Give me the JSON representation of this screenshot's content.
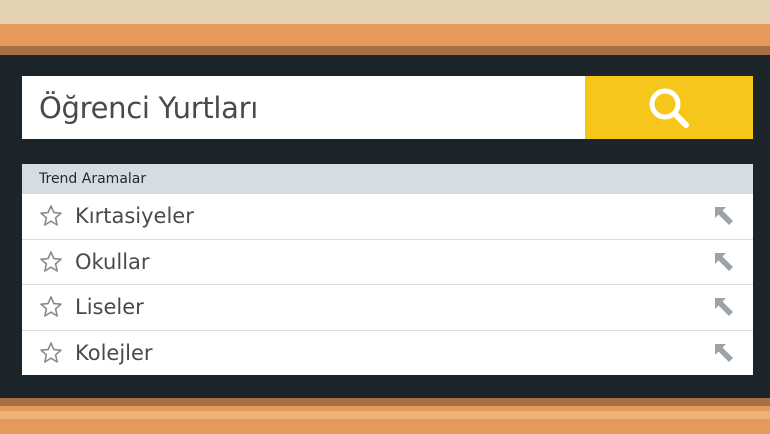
{
  "search": {
    "query": "Öğrenci Yurtları",
    "button_icon": "search-icon"
  },
  "trending": {
    "title": "Trend Aramalar",
    "items": [
      {
        "label": "Kırtasiyeler"
      },
      {
        "label": "Okullar"
      },
      {
        "label": "Liseler"
      },
      {
        "label": "Kolejler"
      }
    ],
    "item_icon": "star-outline-icon",
    "fill_icon": "arrow-up-left-icon"
  },
  "colors": {
    "accent": "#f6c61b",
    "background": "#1b2529",
    "header_bg": "#d4dde3",
    "orange": "#e59a5c"
  }
}
